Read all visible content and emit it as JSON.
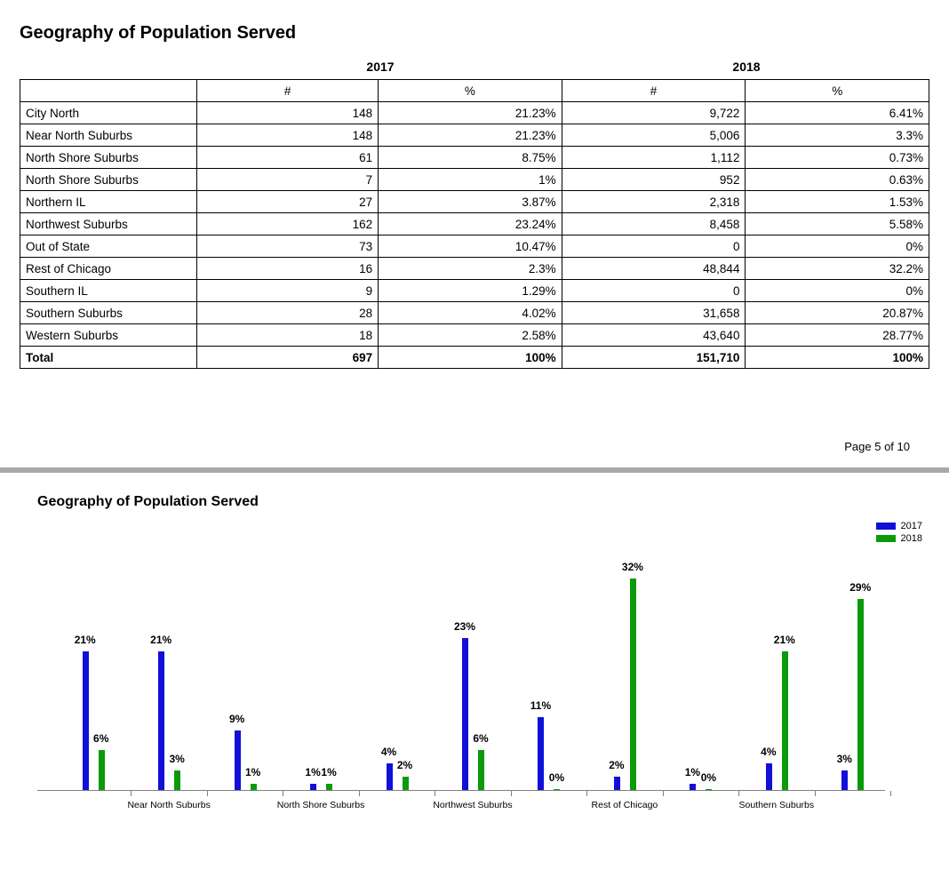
{
  "title": "Geography of Population Served",
  "years": [
    "2017",
    "2018"
  ],
  "col_headers": [
    "#",
    "%",
    "#",
    "%"
  ],
  "rows": [
    {
      "label": "City North",
      "n17": "148",
      "p17": "21.23%",
      "n18": "9,722",
      "p18": "6.41%"
    },
    {
      "label": "Near North Suburbs",
      "n17": "148",
      "p17": "21.23%",
      "n18": "5,006",
      "p18": "3.3%"
    },
    {
      "label": "North Shore Suburbs",
      "n17": "61",
      "p17": "8.75%",
      "n18": "1,112",
      "p18": "0.73%"
    },
    {
      "label": "North Shore Suburbs",
      "n17": "7",
      "p17": "1%",
      "n18": "952",
      "p18": "0.63%"
    },
    {
      "label": "Northern IL",
      "n17": "27",
      "p17": "3.87%",
      "n18": "2,318",
      "p18": "1.53%"
    },
    {
      "label": "Northwest Suburbs",
      "n17": "162",
      "p17": "23.24%",
      "n18": "8,458",
      "p18": "5.58%"
    },
    {
      "label": "Out of State",
      "n17": "73",
      "p17": "10.47%",
      "n18": "0",
      "p18": "0%"
    },
    {
      "label": "Rest of Chicago",
      "n17": "16",
      "p17": "2.3%",
      "n18": "48,844",
      "p18": "32.2%"
    },
    {
      "label": "Southern IL",
      "n17": "9",
      "p17": "1.29%",
      "n18": "0",
      "p18": "0%"
    },
    {
      "label": "Southern Suburbs",
      "n17": "28",
      "p17": "4.02%",
      "n18": "31,658",
      "p18": "20.87%"
    },
    {
      "label": "Western Suburbs",
      "n17": "18",
      "p17": "2.58%",
      "n18": "43,640",
      "p18": "28.77%"
    }
  ],
  "total": {
    "label": "Total",
    "n17": "697",
    "p17": "100%",
    "n18": "151,710",
    "p18": "100%"
  },
  "page_footer": "Page 5 of 10",
  "chart_title": "Geography of Population Served",
  "legend": [
    "2017",
    "2018"
  ],
  "colors": {
    "2017": "#1010d8",
    "2018": "#0a9a0a"
  },
  "chart_data": {
    "type": "bar",
    "title": "Geography of Population Served",
    "ylabel": "%",
    "ylim": [
      0,
      35
    ],
    "categories": [
      "City North",
      "Near North Suburbs",
      "North Shore Suburbs",
      "North Shore Suburbs",
      "Northern IL",
      "Northwest Suburbs",
      "Out of State",
      "Rest of Chicago",
      "Southern IL",
      "Southern Suburbs",
      "Western Suburbs"
    ],
    "visible_category_labels": [
      "Near North Suburbs",
      "North Shore Suburbs",
      "Northwest Suburbs",
      "Rest of Chicago",
      "Southern Suburbs"
    ],
    "series": [
      {
        "name": "2017",
        "values": [
          21,
          21,
          9,
          1,
          4,
          23,
          11,
          2,
          1,
          4,
          3
        ]
      },
      {
        "name": "2018",
        "values": [
          6,
          3,
          1,
          1,
          2,
          6,
          0,
          32,
          0,
          21,
          29
        ]
      }
    ],
    "value_labels": [
      [
        "21%",
        "21%",
        "9%",
        "1%",
        "4%",
        "23%",
        "11%",
        "2%",
        "1%",
        "4%",
        "3%"
      ],
      [
        "6%",
        "3%",
        "1%",
        "1%",
        "2%",
        "6%",
        "0%",
        "32%",
        "0%",
        "21%",
        "29%"
      ]
    ]
  }
}
